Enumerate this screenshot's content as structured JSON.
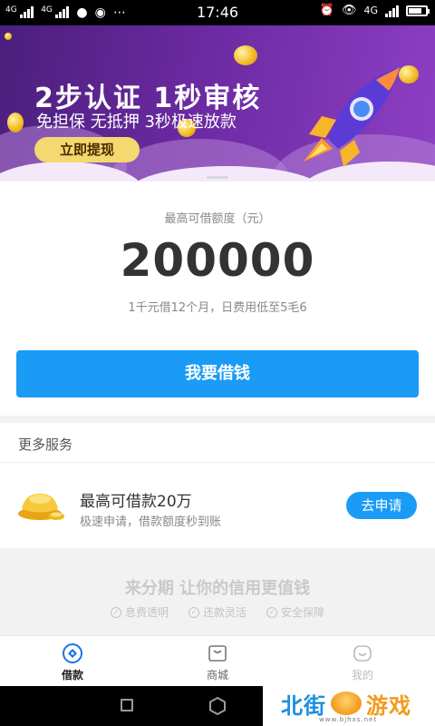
{
  "status_bar": {
    "sim1": "4G",
    "sim2": "4G",
    "time": "17:46",
    "network": "4G",
    "battery_level": 0.8
  },
  "banner": {
    "title": "2步认证  1秒审核",
    "subtitle": "免担保 无抵押 3秒极速放款",
    "button_label": "立即提现",
    "colors": {
      "bg_start": "#4a1f7c",
      "bg_end": "#8e3fc4",
      "button": "#f4d870"
    }
  },
  "loan": {
    "limit_label": "最高可借额度（元）",
    "limit_amount": "200000",
    "fee_note": "1千元借12个月，日费用低至5毛6",
    "borrow_button": "我要借钱"
  },
  "services": {
    "section_title": "更多服务",
    "items": [
      {
        "icon": "gold-ingot-icon",
        "title": "最高可借款20万",
        "description": "极速申请，借款额度秒到账",
        "action_label": "去申请"
      }
    ]
  },
  "slogan": {
    "title": "来分期  让你的信用更值钱",
    "tags": [
      "息费透明",
      "还款灵活",
      "安全保障"
    ]
  },
  "tabbar": {
    "tabs": [
      {
        "label": "借款",
        "icon": "loan-icon",
        "state": "active"
      },
      {
        "label": "商城",
        "icon": "shop-icon",
        "state": "inactive"
      },
      {
        "label": "我的",
        "icon": "profile-icon",
        "state": "faded"
      }
    ]
  },
  "watermark": {
    "text_left": "北街",
    "text_right": "游戏",
    "sub": "www.bjhxs.net"
  },
  "colors": {
    "accent": "#1a9bf5",
    "text_primary": "#333333",
    "text_secondary": "#888888"
  }
}
